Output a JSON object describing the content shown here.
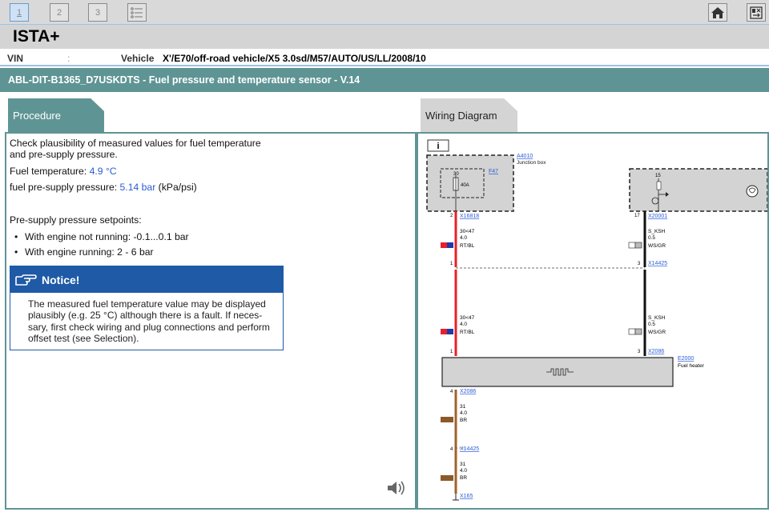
{
  "toolbar": {
    "buttons": [
      {
        "label": "1",
        "active": true
      },
      {
        "label": "2",
        "active": false
      },
      {
        "label": "3",
        "active": false
      }
    ],
    "icons": [
      "list-icon",
      "home-icon",
      "exit-icon"
    ]
  },
  "app": {
    "title": "ISTA+"
  },
  "vehicle_bar": {
    "vin_label": "VIN",
    "vin_value": ":",
    "vehicle_label": "Vehicle",
    "vehicle_value": "X'/E70/off-road vehicle/X5 3.0sd/M57/AUTO/US/LL/2008/10"
  },
  "header": {
    "title": "ABL-DIT-B1365_D7USKDTS - Fuel pressure and temperature sensor - V.14"
  },
  "tabs": {
    "procedure": "Procedure",
    "wiring": "Wiring Diagram"
  },
  "procedure": {
    "intro_line1": "Check plausibility of measured values for fuel temperature",
    "intro_line2": "and pre-supply pressure.",
    "fuel_temp_label": "Fuel temperature:",
    "fuel_temp_value": "4.9 °C",
    "pressure_label": "fuel pre-supply pressure:",
    "pressure_value": "5.14 bar",
    "pressure_unit": "(kPa/psi)",
    "setpoints_heading": "Pre-supply pressure setpoints:",
    "setpoints": [
      "With engine not running: -0.1...0.1 bar",
      "With engine running: 2 - 6 bar"
    ],
    "notice_title": "Notice!",
    "notice_lines": [
      "The measured fuel temperature value may be displayed",
      "plausibly (e.g. 25 °C) although there is a fault. If neces-",
      "sary, first check wiring and plug connections and perform",
      "offset test (see Selection)."
    ]
  },
  "wiring": {
    "info_label": "i",
    "junction_box": {
      "id": "A4010",
      "name": "Junction box",
      "fuse_id": "F47",
      "fuse_slot": "30",
      "fuse_rating": "40A"
    },
    "right_unit": {
      "pin": "15"
    },
    "connectors": {
      "x16818": "X16818",
      "x16818_pin": "2",
      "x20001": "X20001",
      "x20001_pin": "17",
      "x14425_top": "X14425",
      "x14425_top_pin_l": "1",
      "x14425_top_pin_r": "3",
      "x2086_top": "X2086",
      "x2086_top_pin_l": "1",
      "x2086_top_pin_r": "3",
      "x2086_bot": "X2086",
      "x2086_bot_pin": "4",
      "x14425_bot": "X14425",
      "x14425_bot_pin": "4",
      "x165": "X165"
    },
    "wires": {
      "red1": [
        "30<47",
        "4.0",
        "RT/BL"
      ],
      "black1": [
        "S_KSH",
        "0.5",
        "WS/GR"
      ],
      "red2": [
        "30<47",
        "4.0",
        "RT/BL"
      ],
      "black2": [
        "S_KSH",
        "0.5",
        "WS/GR"
      ],
      "brown1": [
        "31",
        "4.0",
        "BR"
      ],
      "brown2": [
        "31",
        "4.0",
        "BR"
      ]
    },
    "heater": {
      "id": "E2000",
      "name": "Fuel heater"
    },
    "colors": {
      "red": "#e8202a",
      "black": "#111111",
      "brown": "#a0622d",
      "blue": "#1f5aa6",
      "teal": "#5f9494"
    }
  }
}
